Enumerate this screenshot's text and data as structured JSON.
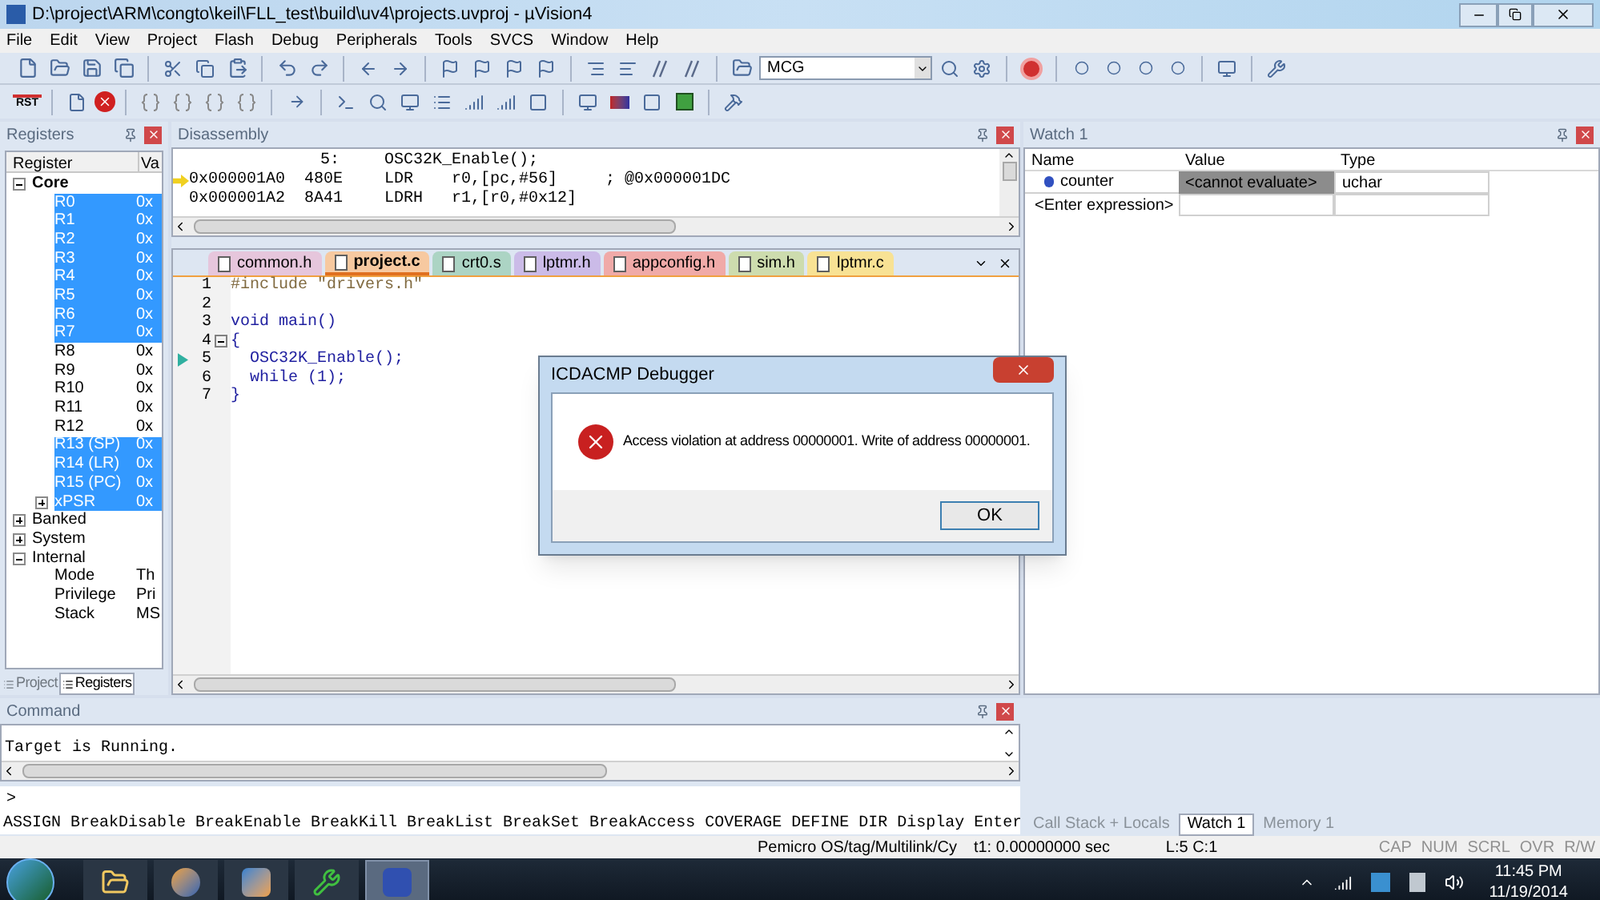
{
  "window": {
    "title": "D:\\project\\ARM\\congto\\keil\\FLL_test\\build\\uv4\\projects.uvproj - µVision4"
  },
  "menu": [
    "File",
    "Edit",
    "View",
    "Project",
    "Flash",
    "Debug",
    "Peripherals",
    "Tools",
    "SVCS",
    "Window",
    "Help"
  ],
  "toolbar": {
    "target_combo": "MCG",
    "reset_label": "RST"
  },
  "registers_panel": {
    "title": "Registers",
    "columns": [
      "Register",
      "Va"
    ],
    "tree": [
      {
        "name": "Core",
        "expanded": true,
        "children": [
          {
            "name": "R0",
            "value": "0x",
            "selected": true
          },
          {
            "name": "R1",
            "value": "0x",
            "selected": true
          },
          {
            "name": "R2",
            "value": "0x",
            "selected": true
          },
          {
            "name": "R3",
            "value": "0x",
            "selected": true
          },
          {
            "name": "R4",
            "value": "0x",
            "selected": true
          },
          {
            "name": "R5",
            "value": "0x",
            "selected": true
          },
          {
            "name": "R6",
            "value": "0x",
            "selected": true
          },
          {
            "name": "R7",
            "value": "0x",
            "selected": true
          },
          {
            "name": "R8",
            "value": "0x",
            "selected": false
          },
          {
            "name": "R9",
            "value": "0x",
            "selected": false
          },
          {
            "name": "R10",
            "value": "0x",
            "selected": false
          },
          {
            "name": "R11",
            "value": "0x",
            "selected": false
          },
          {
            "name": "R12",
            "value": "0x",
            "selected": false
          },
          {
            "name": "R13 (SP)",
            "value": "0x",
            "selected": true
          },
          {
            "name": "R14 (LR)",
            "value": "0x",
            "selected": true
          },
          {
            "name": "R15 (PC)",
            "value": "0x",
            "selected": true
          },
          {
            "name": "xPSR",
            "value": "0x",
            "selected": true,
            "expanded": false
          }
        ]
      },
      {
        "name": "Banked",
        "expanded": false
      },
      {
        "name": "System",
        "expanded": false
      },
      {
        "name": "Internal",
        "expanded": true,
        "children": [
          {
            "name": "Mode",
            "value": "Th",
            "selected": false
          },
          {
            "name": "Privilege",
            "value": "Pri",
            "selected": false
          },
          {
            "name": "Stack",
            "value": "MS",
            "selected": false
          }
        ]
      }
    ],
    "tabs": [
      {
        "label": "Project",
        "selected": false
      },
      {
        "label": "Registers",
        "selected": true
      }
    ]
  },
  "disassembly": {
    "title": "Disassembly",
    "lines": [
      {
        "kind": "source",
        "address": "5:",
        "mnemonic": "OSC32K_Enable();",
        "current": false
      },
      {
        "kind": "instruction",
        "address": "0x000001A0",
        "code": "480E",
        "mnemonic": "LDR",
        "operands": "r0,[pc,#56]",
        "comment": "; @0x000001DC",
        "current": true
      },
      {
        "kind": "instruction",
        "address": "0x000001A2",
        "code": "8A41",
        "mnemonic": "LDRH",
        "operands": "r1,[r0,#0x12]",
        "current": false
      }
    ]
  },
  "editor": {
    "tabs": [
      {
        "label": "common.h",
        "color": "#e6c6dc",
        "selected": false
      },
      {
        "label": "project.c",
        "color": "#f7c9a0",
        "selected": true
      },
      {
        "label": "crt0.s",
        "color": "#acd4c4",
        "selected": false
      },
      {
        "label": "lptmr.h",
        "color": "#cbbbe8",
        "selected": false
      },
      {
        "label": "appconfig.h",
        "color": "#f0aaa8",
        "selected": false
      },
      {
        "label": "sim.h",
        "color": "#cddcae",
        "selected": false
      },
      {
        "label": "lptmr.c",
        "color": "#f8e294",
        "selected": false
      }
    ],
    "lines": [
      {
        "number": "1",
        "text": "#include \"drivers.h\"",
        "kind": "preprocessor",
        "current": false,
        "fold": false
      },
      {
        "number": "2",
        "kind": "blank",
        "current": false,
        "fold": false
      },
      {
        "number": "3",
        "text": "void main()",
        "kind": "plain",
        "current": false,
        "fold": false
      },
      {
        "number": "4",
        "text": "{",
        "kind": "plain",
        "current": false,
        "fold": true
      },
      {
        "number": "5",
        "text": "  OSC32K_Enable();",
        "kind": "plain",
        "current": true,
        "fold": false
      },
      {
        "number": "6",
        "text": "  while (1);",
        "kind": "plain",
        "current": false,
        "fold": false
      },
      {
        "number": "7",
        "text": "}",
        "kind": "plain",
        "current": false,
        "fold": false
      }
    ]
  },
  "watch": {
    "title": "Watch 1",
    "columns": [
      "Name",
      "Value",
      "Type"
    ],
    "rows": [
      {
        "name": "counter",
        "value": "<cannot evaluate>",
        "type": "uchar"
      }
    ],
    "placeholder": "<Enter expression>",
    "tabs": [
      {
        "label": "Call Stack + Locals",
        "selected": false
      },
      {
        "label": "Watch 1",
        "selected": true
      },
      {
        "label": "Memory 1",
        "selected": false
      }
    ]
  },
  "command": {
    "title": "Command",
    "output": "Target is Running.",
    "prompt": ">",
    "hints": "ASSIGN BreakDisable BreakEnable BreakKill BreakList BreakSet BreakAccess COVERAGE DEFINE DIR Display Enter"
  },
  "status_bar": [
    "Pemicro OS/tag/Multilink/Cy",
    "t1: 0.00000000 sec",
    "L:5 C:1"
  ],
  "indicators": [
    "CAP",
    "NUM",
    "SCRL",
    "OVR",
    "R/W"
  ],
  "dialog": {
    "title": "ICDACMP Debugger",
    "message": "Access violation at address 00000001. Write of address 00000001.",
    "button": "OK"
  },
  "taskbar": {
    "time": "11:45 PM",
    "date": "11/19/2014"
  }
}
